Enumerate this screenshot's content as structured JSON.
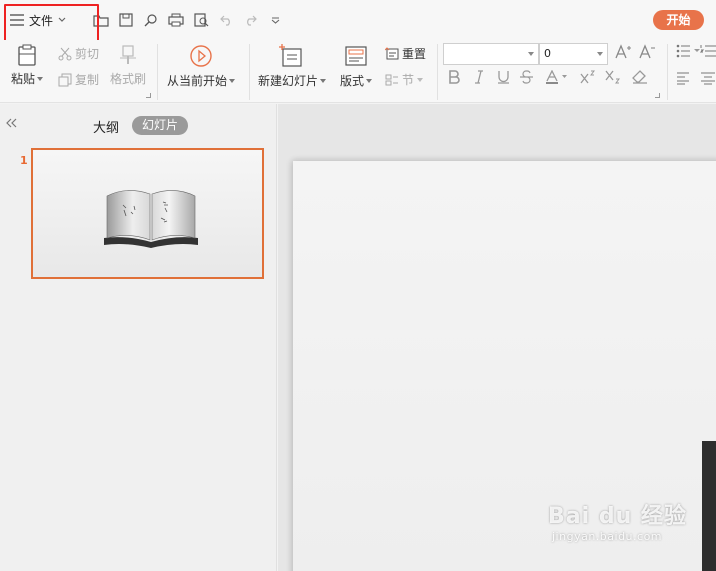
{
  "menu": {
    "file_label": "文件"
  },
  "start_button": "开始",
  "ribbon": {
    "paste": "粘贴",
    "cut": "剪切",
    "copy": "复制",
    "format_painter": "格式刷",
    "from_current": "从当前开始",
    "new_slide": "新建幻灯片",
    "layout": "版式",
    "reset": "重置",
    "section": "节",
    "font_size_value": "0"
  },
  "panel": {
    "tab_outline": "大纲",
    "tab_slides": "幻灯片",
    "slide_number": "1"
  },
  "watermark": {
    "brand": "Bai du 经验",
    "url": "jingyan.baidu.com"
  },
  "colors": {
    "accent": "#e8734a",
    "highlight_box": "#e22222",
    "selected_border": "#e07038"
  }
}
